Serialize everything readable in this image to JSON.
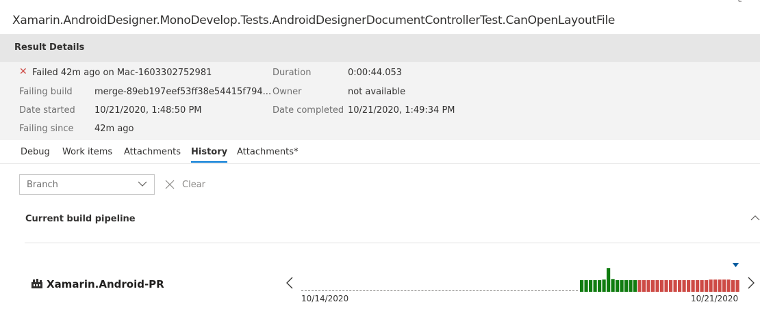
{
  "title": "Xamarin.AndroidDesigner.MonoDevelop.Tests.AndroidDesignerDocumentControllerTest.CanOpenLayoutFile",
  "result_header": "Result Details",
  "details": {
    "status": "Failed 42m ago on Mac-1603302752981",
    "failing_build_label": "Failing build",
    "failing_build_value": "merge-89eb197eef53ff38e54415f794...",
    "date_started_label": "Date started",
    "date_started_value": "10/21/2020, 1:48:50 PM",
    "failing_since_label": "Failing since",
    "failing_since_value": "42m ago",
    "duration_label": "Duration",
    "duration_value": "0:00:44.053",
    "owner_label": "Owner",
    "owner_value": "not available",
    "date_completed_label": "Date completed",
    "date_completed_value": "10/21/2020, 1:49:34 PM"
  },
  "tabs": [
    {
      "label": "Debug",
      "active": false
    },
    {
      "label": "Work items",
      "active": false
    },
    {
      "label": "Attachments",
      "active": false
    },
    {
      "label": "History",
      "active": true
    },
    {
      "label": "Attachments*",
      "active": false
    }
  ],
  "filter": {
    "branch_placeholder": "Branch",
    "clear_label": "Clear"
  },
  "section": {
    "title": "Current build pipeline"
  },
  "pipeline": {
    "name": "Xamarin.Android-PR",
    "icon": "pipeline-icon"
  },
  "colors": {
    "passed": "#107c10",
    "failed": "#cd4a45",
    "accent": "#0078d4"
  },
  "chart_data": {
    "type": "bar",
    "x_start_label": "10/14/2020",
    "x_end_label": "10/21/2020",
    "bars": [
      {
        "outcome": "passed",
        "duration": 1
      },
      {
        "outcome": "passed",
        "duration": 1
      },
      {
        "outcome": "passed",
        "duration": 1
      },
      {
        "outcome": "passed",
        "duration": 1
      },
      {
        "outcome": "passed",
        "duration": 1
      },
      {
        "outcome": "passed",
        "duration": 1.05
      },
      {
        "outcome": "passed",
        "duration": 2.05
      },
      {
        "outcome": "passed",
        "duration": 1.1
      },
      {
        "outcome": "passed",
        "duration": 1
      },
      {
        "outcome": "passed",
        "duration": 1
      },
      {
        "outcome": "passed",
        "duration": 1
      },
      {
        "outcome": "passed",
        "duration": 1
      },
      {
        "outcome": "passed",
        "duration": 1
      },
      {
        "outcome": "failed",
        "duration": 1
      },
      {
        "outcome": "failed",
        "duration": 1
      },
      {
        "outcome": "failed",
        "duration": 1
      },
      {
        "outcome": "failed",
        "duration": 1
      },
      {
        "outcome": "failed",
        "duration": 1
      },
      {
        "outcome": "failed",
        "duration": 1
      },
      {
        "outcome": "failed",
        "duration": 1
      },
      {
        "outcome": "failed",
        "duration": 1
      },
      {
        "outcome": "failed",
        "duration": 1
      },
      {
        "outcome": "failed",
        "duration": 1
      },
      {
        "outcome": "failed",
        "duration": 1
      },
      {
        "outcome": "failed",
        "duration": 1
      },
      {
        "outcome": "failed",
        "duration": 1
      },
      {
        "outcome": "failed",
        "duration": 1
      },
      {
        "outcome": "failed",
        "duration": 1
      },
      {
        "outcome": "failed",
        "duration": 1
      },
      {
        "outcome": "failed",
        "duration": 1.05
      },
      {
        "outcome": "failed",
        "duration": 1.05
      },
      {
        "outcome": "failed",
        "duration": 1.05
      },
      {
        "outcome": "failed",
        "duration": 1.05
      },
      {
        "outcome": "failed",
        "duration": 1.05
      },
      {
        "outcome": "failed",
        "duration": 1
      },
      {
        "outcome": "failed",
        "duration": 1
      }
    ]
  }
}
